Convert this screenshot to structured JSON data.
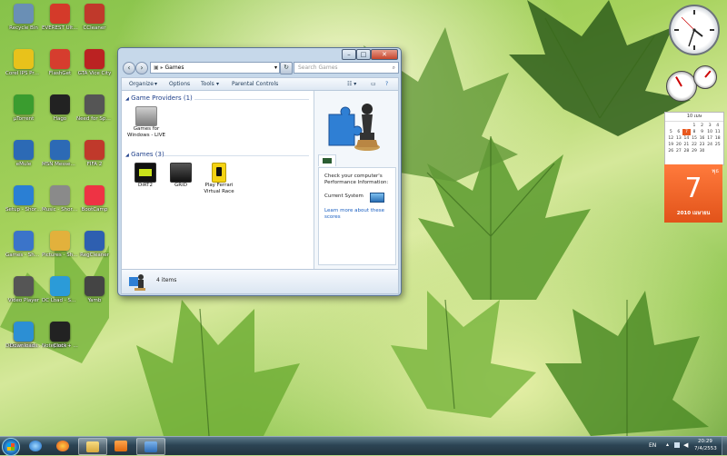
{
  "desktop_icons": [
    {
      "label": "Recycle Bin",
      "icon": "recycle-bin-icon",
      "color": "#6a8fb5"
    },
    {
      "label": "EVEREST Ultimate",
      "icon": "everest-icon",
      "color": "#d43a2a"
    },
    {
      "label": "CCleaner",
      "icon": "ccleaner-icon",
      "color": "#c0392b"
    },
    {
      "label": "Corel IPS Professional",
      "icon": "corel-icon",
      "color": "#e8c21b"
    },
    {
      "label": "FlashGet",
      "icon": "flashget-icon",
      "color": "#d63d2e"
    },
    {
      "label": "GTA Vice City",
      "icon": "game-icon",
      "color": "#b22"
    },
    {
      "label": "µTorrent",
      "icon": "utorrent-icon",
      "color": "#3a9c2f"
    },
    {
      "label": "Hago",
      "icon": "hago-icon",
      "color": "#222"
    },
    {
      "label": "Need for Speed Most Wanted",
      "icon": "nfs-icon",
      "color": "#555"
    },
    {
      "label": "eMule",
      "icon": "emule-icon",
      "color": "#2c6ab5"
    },
    {
      "label": "MSN Messenger - Shortcut",
      "icon": "msn-icon",
      "color": "#2c6ab5"
    },
    {
      "label": "FIFA 2",
      "icon": "fifa-icon",
      "color": "#c0392b"
    },
    {
      "label": "Setup - Shortcut",
      "icon": "setup-icon",
      "color": "#2a7fd4"
    },
    {
      "label": "Music - Shortcut",
      "icon": "music-icon",
      "color": "#8a8a8a"
    },
    {
      "label": "BootCamp",
      "icon": "bootcamp-icon",
      "color": "#e34"
    },
    {
      "label": "Games - Shortcut",
      "icon": "games-shortcut-icon",
      "color": "#3b74c9"
    },
    {
      "label": "Pictures - Shortcut",
      "icon": "pictures-icon",
      "color": "#e2b13c"
    },
    {
      "label": "RegCleaner",
      "icon": "regcleaner-icon",
      "color": "#2e5fb0"
    },
    {
      "label": "Video Player",
      "icon": "video-player-icon",
      "color": "#555"
    },
    {
      "label": "DC Load - Shortcut",
      "icon": "dcload-icon",
      "color": "#2b9bd8"
    },
    {
      "label": "Yamb",
      "icon": "yamb-icon",
      "color": "#444"
    },
    {
      "label": "Documents - Shortcut",
      "icon": "documents-icon",
      "color": "#d9a73a"
    },
    {
      "label": "Notepad++ - Shortcut",
      "icon": "notepad-icon",
      "color": "#5a8f3a"
    },
    {
      "label": "Downloads",
      "icon": "downloads-icon",
      "color": "#2c8fd4"
    },
    {
      "label": "Clock",
      "icon": "clock-icon",
      "color": "#222"
    }
  ],
  "window": {
    "address": "Games",
    "search_placeholder": "Search Games",
    "toolbar": [
      "Organize",
      "Options",
      "Tools",
      "Parental Controls"
    ],
    "groups": [
      {
        "title": "Game Providers (1)",
        "items": [
          {
            "label": "Games for Windows - LIVE",
            "icon": "games-for-windows-live-icon"
          }
        ]
      },
      {
        "title": "Games (3)",
        "items": [
          {
            "label": "DiRT2",
            "icon": "dirt2-icon"
          },
          {
            "label": "GRID",
            "icon": "grid-icon"
          },
          {
            "label": "Play Ferrari Virtual Race",
            "icon": "ferrari-icon"
          }
        ]
      }
    ],
    "perf": {
      "title": "Check your computer's Performance Information:",
      "current_system": "Current System",
      "link": "Learn more about these scores"
    },
    "status": "4 items"
  },
  "gadgets": {
    "calendar_header": "10 เมษ",
    "calendar_days": [
      "1",
      "2",
      "3",
      "4",
      "5",
      "6",
      "7",
      "8",
      "9",
      "10",
      "11",
      "12",
      "13",
      "14",
      "15",
      "16",
      "17",
      "18",
      "19",
      "20",
      "21",
      "22",
      "23",
      "24",
      "25",
      "26",
      "27",
      "28",
      "29",
      "30"
    ],
    "weekday": "พุธ",
    "day": "7",
    "year_month": "2010 เมษายน"
  },
  "taskbar": {
    "lang": "EN",
    "time": "20:29",
    "date": "7/4/2553"
  },
  "colors": {
    "accent": "#2c6ab5",
    "calendar_orange": "#e8581e"
  }
}
